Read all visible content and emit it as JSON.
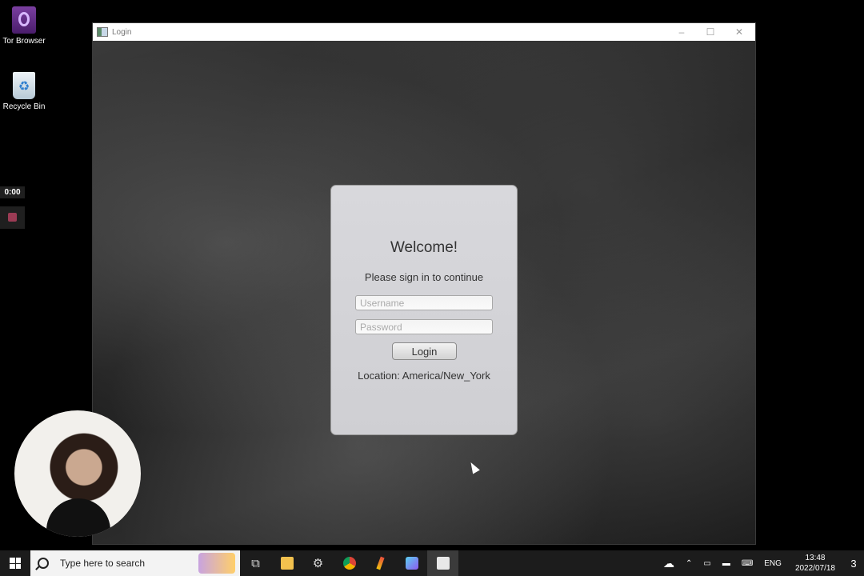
{
  "desktop": {
    "icons": [
      {
        "label": "Tor Browser",
        "icon": "tor-browser-icon"
      },
      {
        "label": "Recycle Bin",
        "icon": "recycle-bin-icon"
      }
    ],
    "recorder": {
      "time": "0:00"
    }
  },
  "window": {
    "title": "Login",
    "controls": {
      "minimize": "–",
      "maximize": "☐",
      "close": "✕"
    }
  },
  "login": {
    "heading": "Welcome!",
    "subtitle": "Please sign in to continue",
    "username_placeholder": "Username",
    "password_placeholder": "Password",
    "button_label": "Login",
    "location": "Location: America/New_York"
  },
  "taskbar": {
    "search_placeholder": "Type here to search",
    "pinned": [
      "task-view-icon",
      "file-explorer-icon",
      "settings-icon",
      "chrome-icon",
      "pen-icon",
      "cube-app-icon",
      "java-app-icon"
    ],
    "tray": {
      "language": "ENG",
      "time": "13:48",
      "date": "2022/07/18",
      "notification_count": "3"
    }
  }
}
